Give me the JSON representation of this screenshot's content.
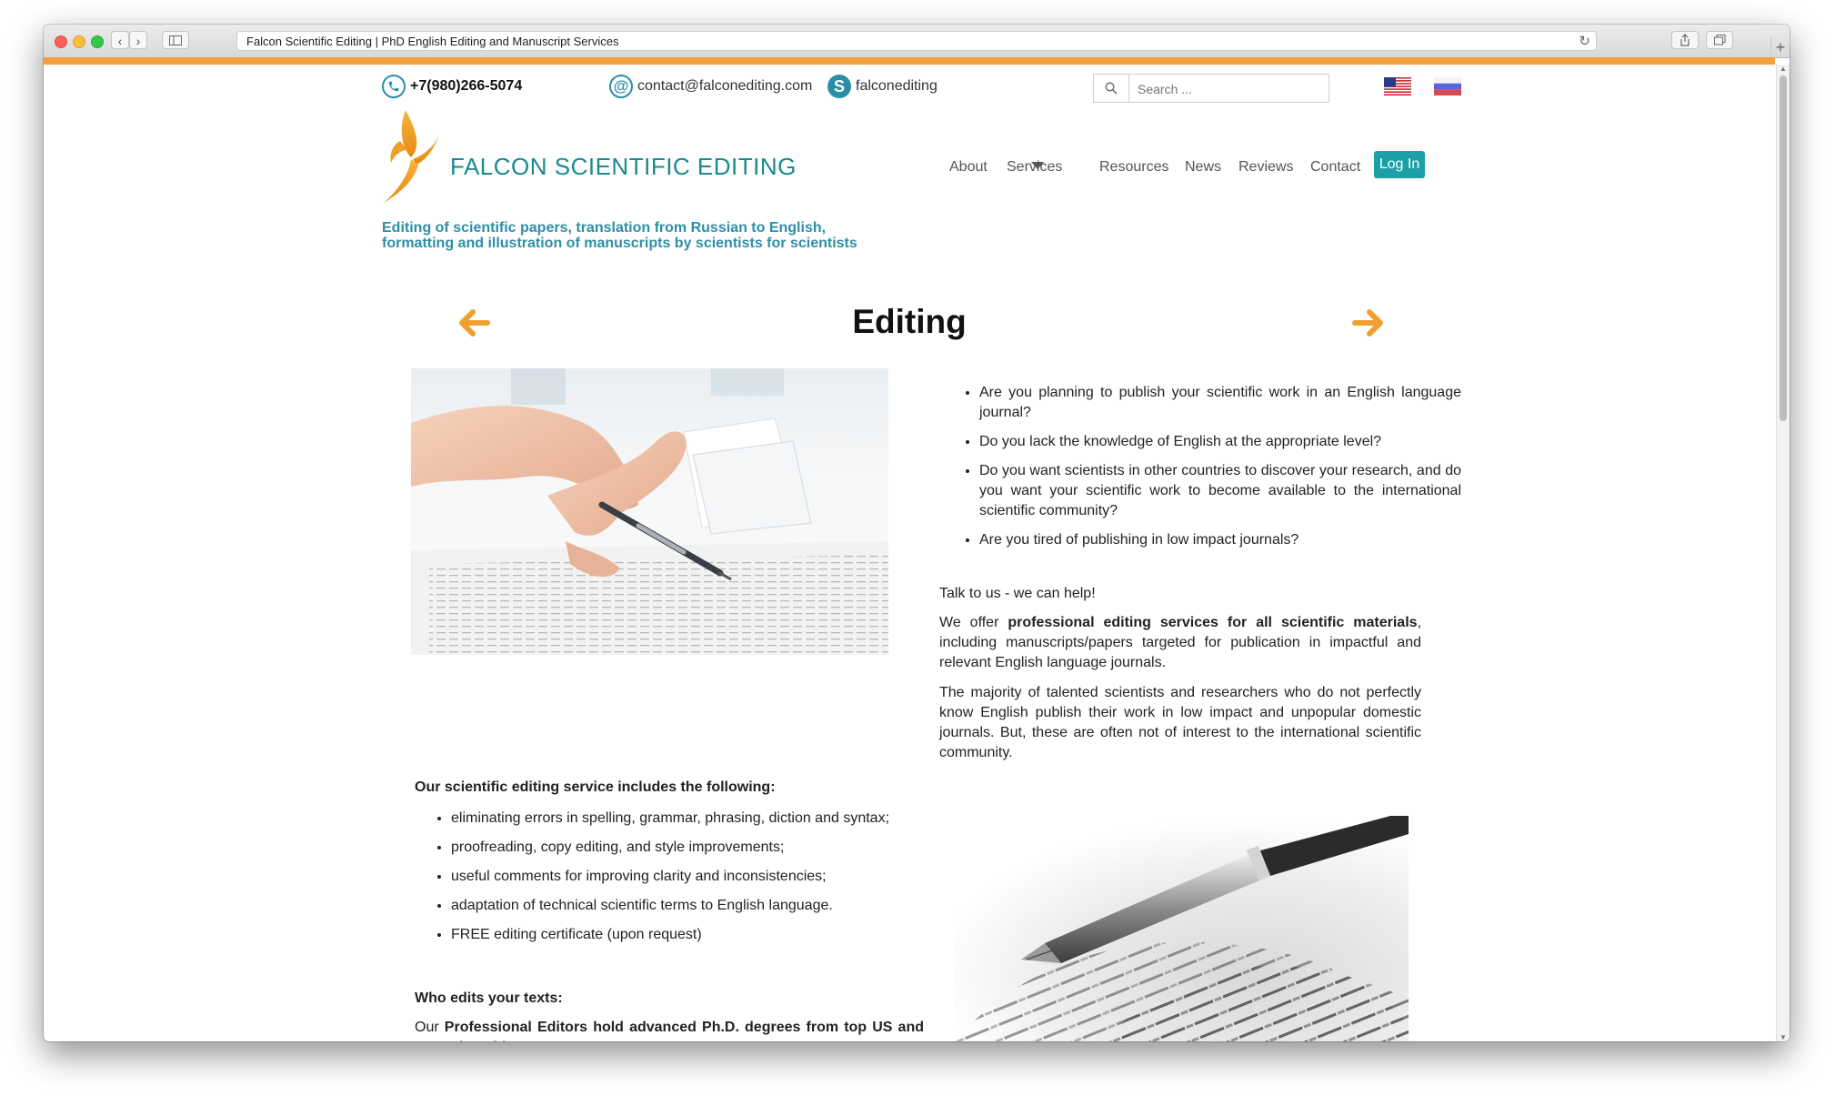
{
  "browser": {
    "tab_title": "Falcon Scientific Editing | PhD English Editing and Manuscript Services"
  },
  "header": {
    "phone": "+7(980)266-5074",
    "email": "contact@falconediting.com",
    "skype": "falconediting",
    "search_placeholder": "Search ...",
    "brand": "FALCON SCIENTIFIC EDITING",
    "tagline": "Editing of scientific papers, translation from Russian to English, formatting and illustration of manuscripts by scientists for scientists"
  },
  "nav": {
    "about": "About",
    "services": "Services",
    "resources": "Resources",
    "news": "News",
    "reviews": "Reviews",
    "contact": "Contact",
    "login": "Log In"
  },
  "main": {
    "title": "Editing",
    "questions": [
      "Are you planning to publish your scientific work in an English language journal?",
      "Do you lack the knowledge of English at the appropriate level?",
      "Do you want scientists in other countries to discover your research, and do you want your scientific work to become available to the international scientific community?",
      "Are you tired of publishing in low impact journals?"
    ],
    "talk": "Talk to us - we can help!",
    "offer_a": "We offer ",
    "offer_bold": "professional editing services for all scientific materials",
    "offer_b": ", including manuscripts/papers targeted for publication in impactful and relevant English language journals.",
    "majority": "The majority of talented scientists and researchers who do not perfectly know English publish their work in low impact and unpopular domestic journals. But, these are often not of interest to the international scientific community.",
    "includes_heading": "Our scientific editing service includes the following:",
    "includes": [
      "eliminating errors in spelling, grammar, phrasing, diction and syntax;",
      "proofreading, copy editing, and style improvements;",
      "useful comments for improving clarity and inconsistencies;",
      "adaptation of technical scientific terms to English language.",
      "FREE editing certificate (upon request)"
    ],
    "who_heading": "Who edits your texts:",
    "who_a": "Our ",
    "who_bold": "Professional Editors hold advanced Ph.D. degrees from top US and UK Universities"
  },
  "colors": {
    "brand_teal": "#1a8a8c",
    "tagline_blue": "#2f8ea7",
    "accent_orange": "#f2a03c",
    "login_bg": "#1aa0a5"
  },
  "icons": [
    "phone-icon",
    "at-icon",
    "skype-icon",
    "search-icon",
    "us-flag",
    "ru-flag",
    "falcon-logo",
    "arrow-left-icon",
    "arrow-right-icon"
  ]
}
